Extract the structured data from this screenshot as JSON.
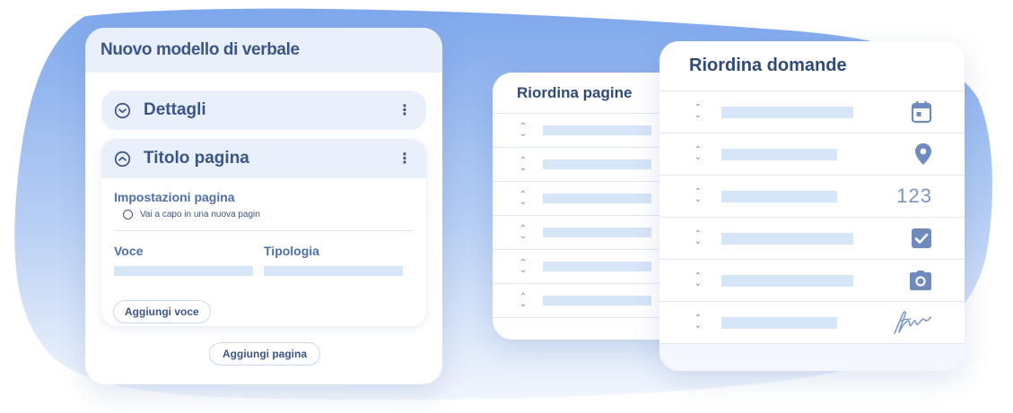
{
  "left_card": {
    "title": "Nuovo modello di verbale",
    "sections": [
      {
        "title": "Dettagli",
        "state": "collapsed",
        "icon": "chevron-down-circle-icon"
      },
      {
        "title": "Titolo pagina",
        "state": "expanded",
        "icon": "chevron-up-circle-icon"
      }
    ],
    "page_settings": {
      "heading": "Impostazioni pagina",
      "option_label": "Vai a capo in una nuova pagin"
    },
    "columns": [
      "Voce",
      "Tipologia"
    ],
    "add_item_label": "Aggiungi voce",
    "add_page_label": "Aggiungi pagina"
  },
  "middle_card": {
    "title": "Riordina pagine",
    "row_count": 6
  },
  "right_card": {
    "title": "Riordina domande",
    "rows": [
      {
        "icon": "calendar-icon"
      },
      {
        "icon": "location-pin-icon"
      },
      {
        "icon": "number-icon",
        "text": "123"
      },
      {
        "icon": "checkbox-icon"
      },
      {
        "icon": "camera-icon"
      },
      {
        "icon": "signature-icon"
      }
    ]
  },
  "colors": {
    "accent": "#3b5585",
    "header_bg": "#e9f0fc",
    "placeholder_bar": "#d6e5f8",
    "icon": "#6f8bbd",
    "background_blob": "#8fb3ee"
  }
}
